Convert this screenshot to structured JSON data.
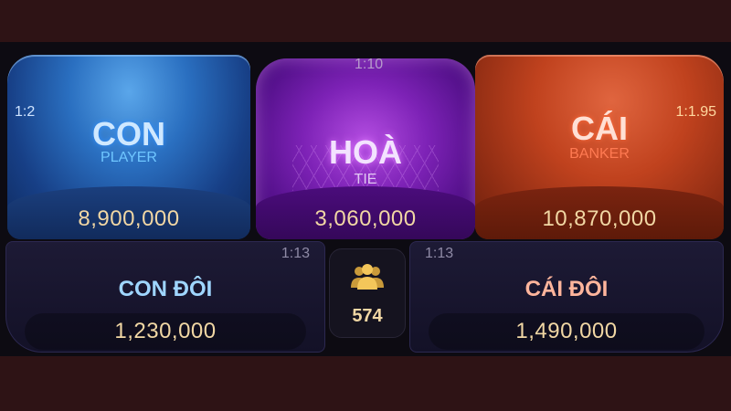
{
  "bets": {
    "player": {
      "title": "CON",
      "subtitle": "PLAYER",
      "ratio": "1:2",
      "amount": "8,900,000"
    },
    "tie": {
      "title": "HOÀ",
      "subtitle": "TIE",
      "ratio": "1:10",
      "amount": "3,060,000"
    },
    "banker": {
      "title": "CÁI",
      "subtitle": "BANKER",
      "ratio": "1:1.95",
      "amount": "10,870,000"
    },
    "player_pair": {
      "title": "CON ĐÔI",
      "ratio": "1:13",
      "amount": "1,230,000"
    },
    "banker_pair": {
      "title": "CÁI ĐÔI",
      "ratio": "1:13",
      "amount": "1,490,000"
    }
  },
  "players_online": {
    "icon": "group-users-icon",
    "count": "574"
  },
  "colors": {
    "player": "#2a6fc0",
    "tie": "#7d22b6",
    "banker": "#c0421e",
    "amount_text": "#f1d7a4"
  }
}
